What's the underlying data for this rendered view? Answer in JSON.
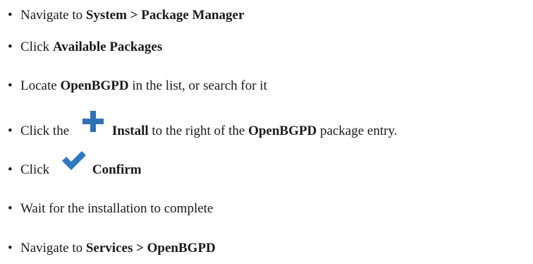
{
  "steps": [
    {
      "text": "Navigate to ",
      "bold": "System > Package Manager"
    },
    {
      "text": "Click ",
      "bold": "Available Packages"
    },
    {
      "text": "Locate ",
      "bold": "OpenBGPD",
      "after": " in the list, or search for it"
    },
    {
      "text": "Click the ",
      "icon": "plus-icon",
      "bold": "Install",
      "after": " to the right of the ",
      "bold2": "OpenBGPD",
      "after2": " package entry."
    },
    {
      "text": "Click ",
      "icon": "checkmark-icon",
      "bold": "Confirm"
    },
    {
      "text": "Wait for the installation to complete"
    },
    {
      "text": "Navigate to ",
      "bold": "Services > OpenBGPD"
    }
  ],
  "bullet": "•",
  "colors": {
    "plus": "#2e72b6",
    "check": "#2e79c2",
    "text": "#1a1a1a"
  }
}
